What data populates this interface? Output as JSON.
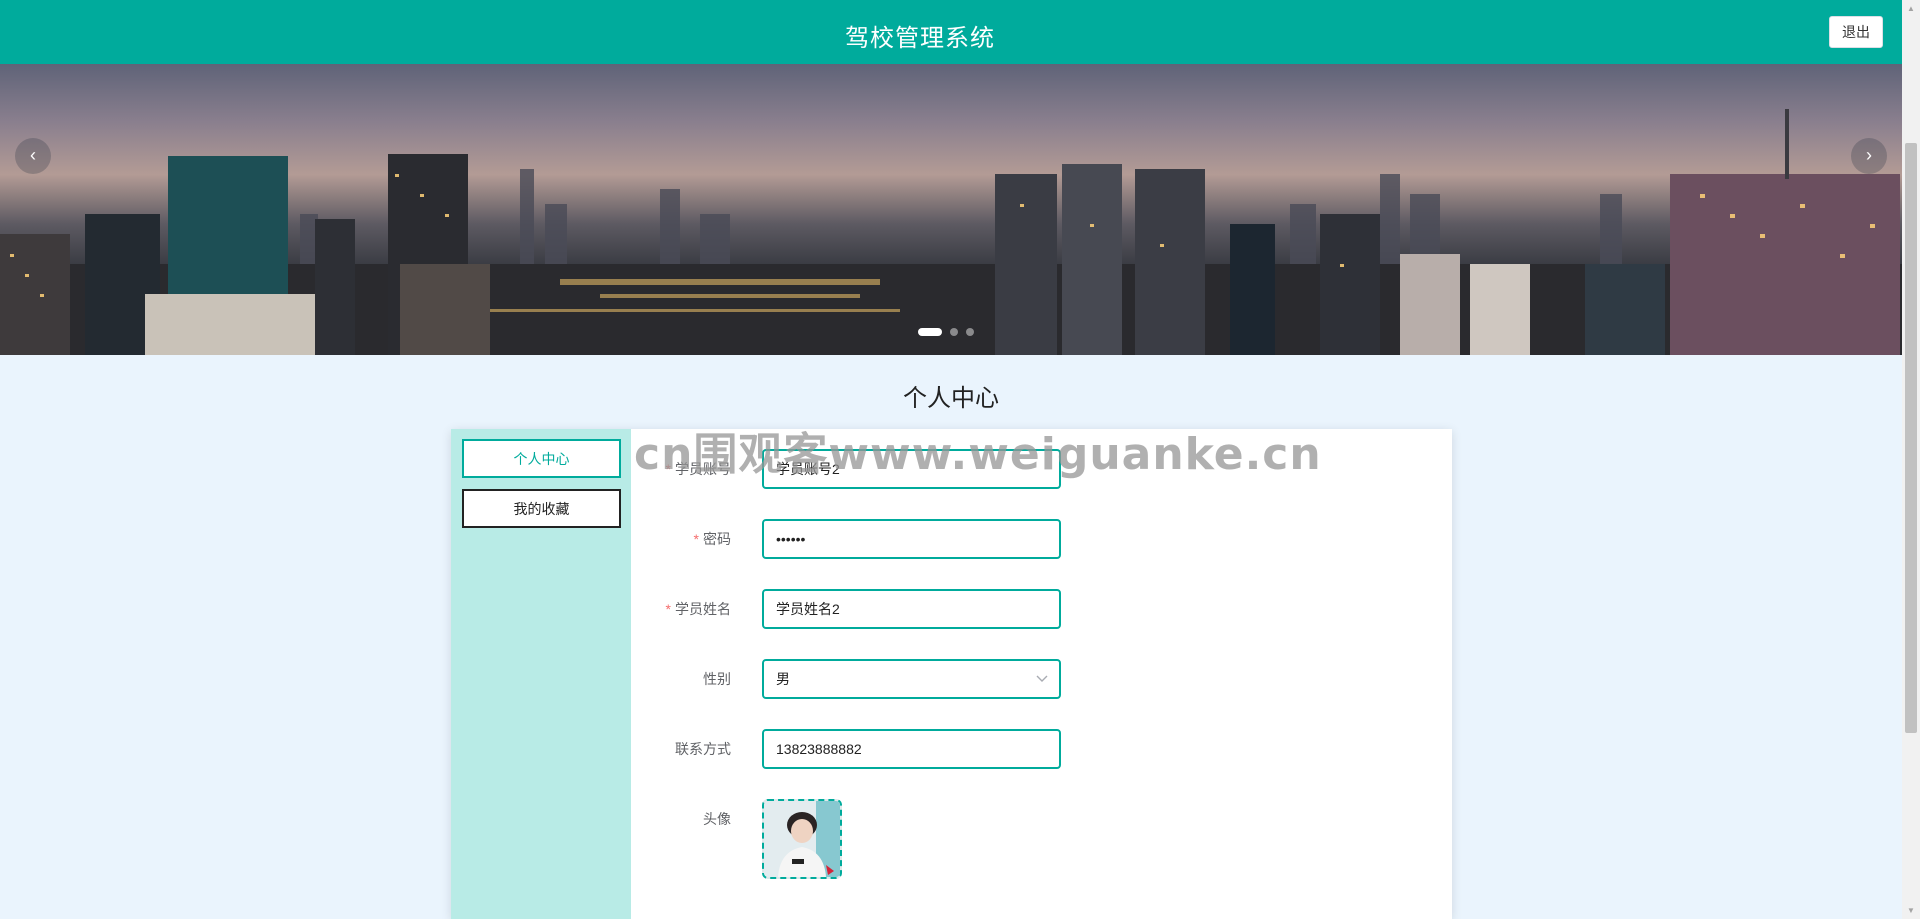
{
  "header": {
    "title": "驾校管理系统",
    "logout_label": "退出"
  },
  "banner": {
    "prev_glyph": "‹",
    "next_glyph": "›",
    "active_slide": 1,
    "slide_count": 3
  },
  "page_title": "个人中心",
  "sidebar": {
    "items": [
      {
        "label": "个人中心",
        "active": true
      },
      {
        "label": "我的收藏",
        "active": false
      }
    ]
  },
  "form": {
    "required_mark": "*",
    "account": {
      "label": "学员账号",
      "value": "学员账号2",
      "required": true
    },
    "password": {
      "label": "密码",
      "value": "••••••",
      "required": true
    },
    "name": {
      "label": "学员姓名",
      "value": "学员姓名2",
      "required": true
    },
    "gender": {
      "label": "性别",
      "value": "男"
    },
    "phone": {
      "label": "联系方式",
      "value": "13823888882"
    },
    "avatar": {
      "label": "头像"
    }
  },
  "watermark": "cn围观客www.weiguanke.cn",
  "colors": {
    "brand": "#00ab9c",
    "sidebar_bg": "#b8ebe6",
    "page_bg": "#eaf4fd",
    "required": "#f56c6c"
  },
  "icons": {
    "select_arrow": "chevron-down-icon",
    "scroll_up": "scroll-up-arrow-icon",
    "scroll_down": "scroll-down-arrow-icon"
  }
}
